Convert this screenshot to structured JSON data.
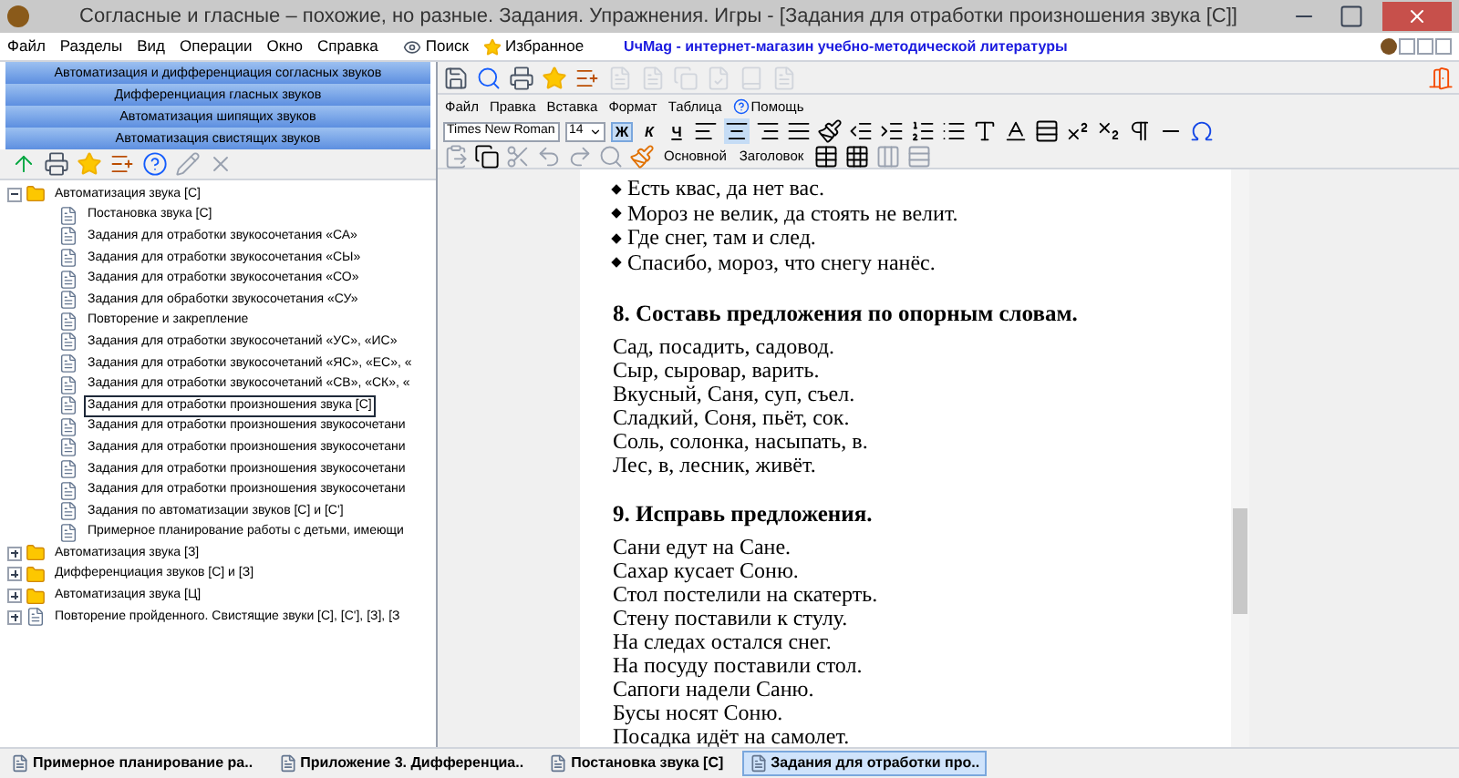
{
  "window": {
    "title": "Согласные и гласные – похожие, но разные. Задания. Упражнения. Игры - [Задания для отработки произношения звука [С]]"
  },
  "menu": {
    "items": [
      "Файл",
      "Разделы",
      "Вид",
      "Операции",
      "Окно",
      "Справка"
    ],
    "search": "Поиск",
    "favorites": "Избранное",
    "link": "UчMag - интернет-магазин учебно-методической литературы"
  },
  "sections": [
    "Автоматизация и дифференциация согласных звуков",
    "Дифференциация гласных звуков",
    "Автоматизация шипящих звуков",
    "Автоматизация свистящих звуков"
  ],
  "tree": [
    {
      "kind": "folder",
      "label": "Автоматизация звука [С]",
      "expanded": true,
      "children": [
        {
          "kind": "doc",
          "label": "Постановка звука [С]",
          "selected": false
        },
        {
          "kind": "doc",
          "label": "Задания для отработки звукосочетания «СА»",
          "selected": false
        },
        {
          "kind": "doc",
          "label": "Задания для отработки звукосочетания «СЫ»",
          "selected": false
        },
        {
          "kind": "doc",
          "label": "Задания для отработки звукосочетания «СО»",
          "selected": false
        },
        {
          "kind": "doc",
          "label": "Задания для обработки звукосочетания «СУ»",
          "selected": false
        },
        {
          "kind": "doc",
          "label": "Повторение и закрепление",
          "selected": false
        },
        {
          "kind": "doc",
          "label": "Задания для отработки звукосочетаний «УС», «ИС»",
          "selected": false
        },
        {
          "kind": "doc",
          "label": "Задания для отработки звукосочетаний «ЯС», «ЕС», «",
          "selected": false
        },
        {
          "kind": "doc",
          "label": "Задания для отработки звукосочетаний «СВ», «СК», «",
          "selected": false
        },
        {
          "kind": "doc",
          "label": "Задания для отработки произношения звука [С]",
          "selected": true
        },
        {
          "kind": "doc",
          "label": "Задания для отработки произношения звукосочетани",
          "selected": false
        },
        {
          "kind": "doc",
          "label": "Задания для отработки произношения звукосочетани",
          "selected": false
        },
        {
          "kind": "doc",
          "label": "Задания для отработки произношения звукосочетани",
          "selected": false
        },
        {
          "kind": "doc",
          "label": "Задания для отработки произношения звукосочетани",
          "selected": false
        },
        {
          "kind": "doc",
          "label": "Задания по автоматизации звуков [С] и [С']",
          "selected": false
        },
        {
          "kind": "doc",
          "label": "Примерное планирование работы с детьми, имеющи",
          "selected": false
        }
      ]
    },
    {
      "kind": "folder",
      "label": "Автоматизация звука [З]",
      "expanded": false
    },
    {
      "kind": "folder",
      "label": "Дифференциация звуков [С] и [З]",
      "expanded": false
    },
    {
      "kind": "folder",
      "label": "Автоматизация звука [Ц]",
      "expanded": false
    },
    {
      "kind": "doc",
      "label": "Повторение пройденного. Свистящие звуки [С], [С'], [З], [З",
      "expanded": false,
      "selected": false
    }
  ],
  "editor": {
    "menu": [
      "Файл",
      "Правка",
      "Вставка",
      "Формат",
      "Таблица",
      "Помощь"
    ],
    "font": "Times New Roman",
    "size": "14",
    "bold": "Ж",
    "italic": "К",
    "underline": "Ч",
    "styles": [
      "Основной",
      "Заголовок"
    ]
  },
  "document": [
    {
      "kind": "bullets",
      "items": [
        "Есть квас, да нет вас.",
        "Мороз не велик, да стоять не велит.",
        "Где снег, там и след.",
        "Спасибо, мороз, что снегу нанёс."
      ]
    },
    {
      "kind": "heading",
      "text": "8. Составь предложения по опорным словам."
    },
    {
      "kind": "lines",
      "items": [
        "Сад, посадить, садовод.",
        "Сыр, сыровар, варить.",
        "Вкусный, Саня, суп, съел.",
        "Сладкий, Соня, пьёт, сок.",
        "Соль, солонка, насыпать, в.",
        "Лес, в, лесник, живёт."
      ]
    },
    {
      "kind": "heading",
      "text": "9. Исправь предложения."
    },
    {
      "kind": "lines",
      "items": [
        "Сани едут на Сане.",
        "Сахар кусает Соню.",
        "Стол постелили на скатерть.",
        "Стену поставили к стулу.",
        "На следах остался снег.",
        "На посуду поставили стол.",
        "Сапоги надели Саню.",
        "Бусы носят Соню.",
        "Посадка идёт на самолет."
      ]
    }
  ],
  "taskbar": [
    {
      "label": "Примерное планирование ра..",
      "selected": false
    },
    {
      "label": "Приложение 3. Дифференциа..",
      "selected": false
    },
    {
      "label": "Постановка звука [С]",
      "selected": false
    },
    {
      "label": "Задания для отработки про..",
      "selected": true
    }
  ]
}
